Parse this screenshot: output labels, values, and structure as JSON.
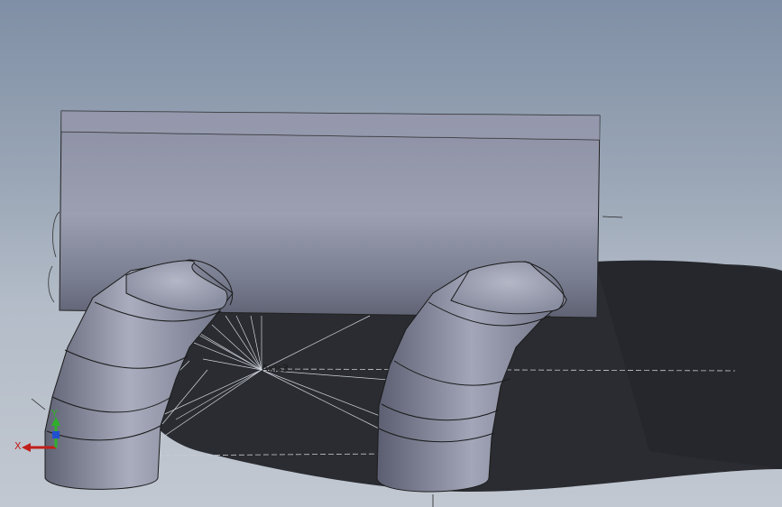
{
  "viewport": {
    "background_top": "#7f8fa5",
    "background_bottom": "#c2c8d1"
  },
  "model": {
    "body_color": "#8f93a6",
    "shadow_color": "#24262b"
  },
  "annotations": {
    "axis_name": "Axis3"
  },
  "triad": {
    "x_label": "X",
    "y_label": "Y",
    "x_color": "#c0201a",
    "y_color": "#2fb02a",
    "z_color": "#2050d0"
  }
}
